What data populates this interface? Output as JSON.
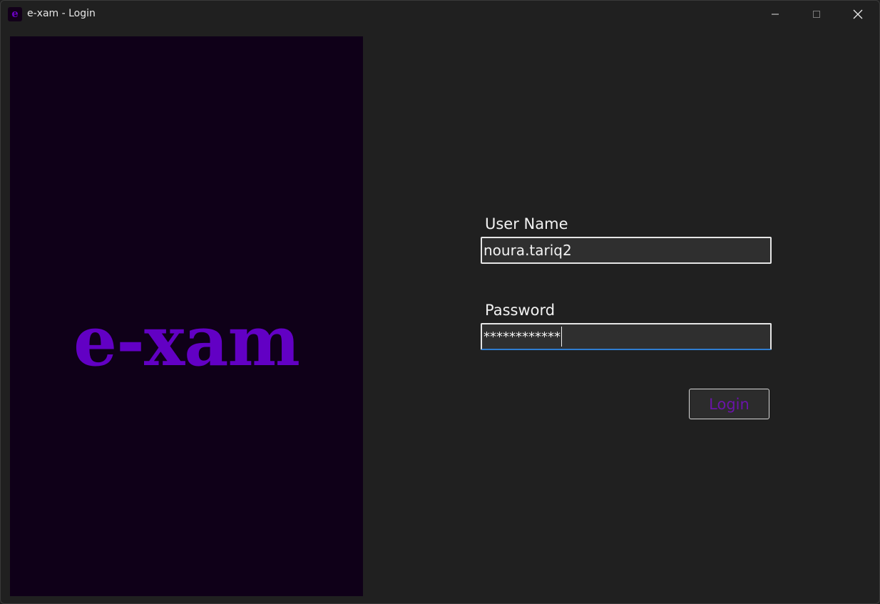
{
  "window": {
    "title": "e-xam - Login",
    "app_icon_glyph": "e",
    "controls": {
      "minimize_icon": "minimize-icon",
      "maximize_icon": "maximize-icon",
      "close_icon": "close-icon"
    }
  },
  "logo": {
    "text": "e-xam",
    "color": "#6200c4",
    "background": "#0f0018"
  },
  "form": {
    "username_label": "User Name",
    "username_value": "noura.tariq2",
    "password_label": "Password",
    "password_value": "************",
    "login_label": "Login"
  },
  "colors": {
    "window_bg": "#202020",
    "field_bg": "#2f2f2f",
    "focus_accent": "#2f7dd1",
    "login_text": "#6a14a8"
  }
}
